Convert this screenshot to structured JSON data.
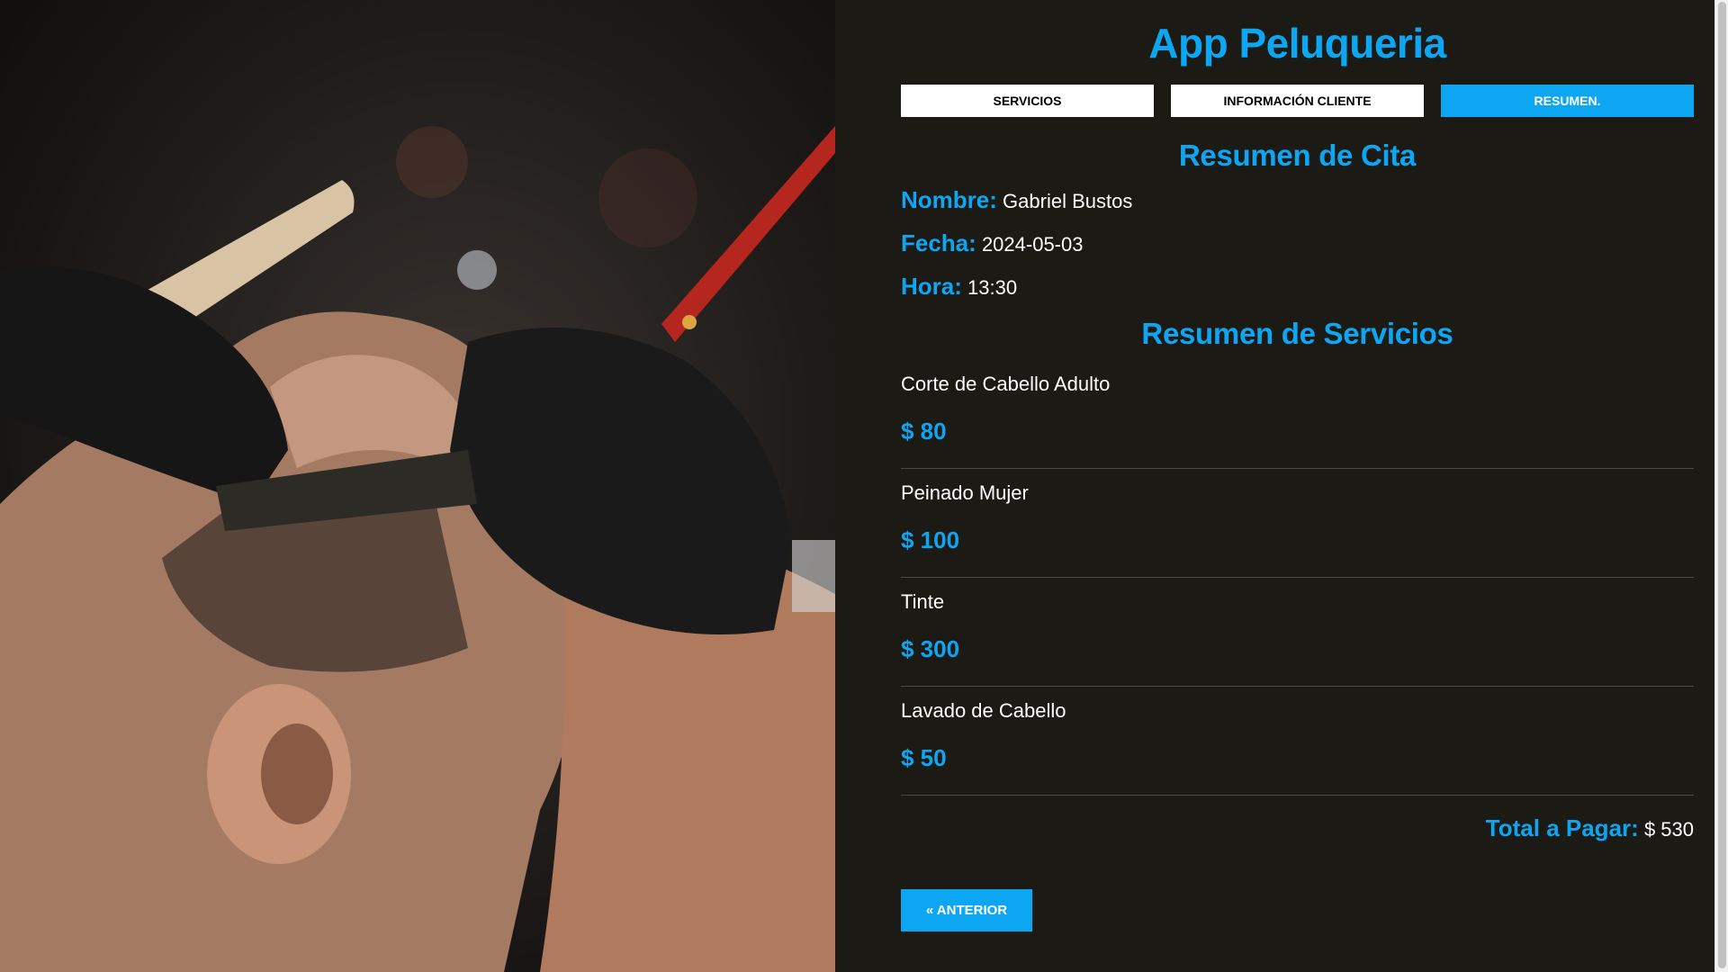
{
  "app": {
    "title": "App Peluqueria"
  },
  "tabs": [
    {
      "label": "Servicios",
      "active": false
    },
    {
      "label": "Información Cliente",
      "active": false
    },
    {
      "label": "Resumen.",
      "active": true
    }
  ],
  "cita": {
    "heading": "Resumen de Cita",
    "nombre_label": "Nombre:",
    "nombre": "Gabriel Bustos",
    "fecha_label": "Fecha:",
    "fecha": "2024-05-03",
    "hora_label": "Hora:",
    "hora": "13:30"
  },
  "servicios": {
    "heading": "Resumen de Servicios",
    "items": [
      {
        "name": "Corte de Cabello Adulto",
        "price": "$ 80"
      },
      {
        "name": "Peinado Mujer",
        "price": "$ 100"
      },
      {
        "name": "Tinte",
        "price": "$ 300"
      },
      {
        "name": "Lavado de Cabello",
        "price": "$ 50"
      }
    ]
  },
  "total": {
    "label": "Total a Pagar:",
    "value": "$ 530"
  },
  "nav": {
    "prev_label": "« Anterior"
  },
  "colors": {
    "accent": "#0da6f3",
    "background": "#1b1a15",
    "text": "#ffffff"
  },
  "image": {
    "subject": "barber-shaving-photo"
  }
}
